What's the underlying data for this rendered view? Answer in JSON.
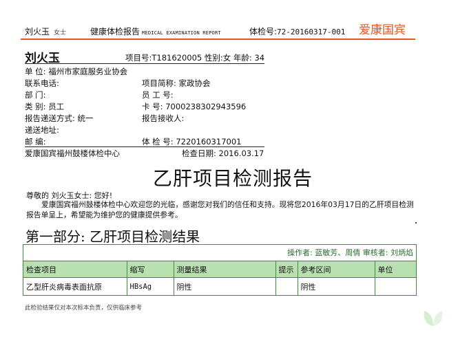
{
  "header": {
    "name": "刘火玉",
    "salutation": "女士",
    "title": "健康体检报告",
    "title_en": "MEDICAL EXAMINATION REPORT",
    "exam_no_label": "体检号:",
    "exam_no": "72-20160317-001",
    "brand": "爱康国宾"
  },
  "patient": {
    "name": "刘火玉",
    "meta": "项目号:T181620005 性别:女 年龄: 34",
    "unit_label": "单    位:",
    "unit": "福州市家庭服务业协会",
    "phone_label": "联系电话:",
    "phone": "",
    "project_abbr_label": "项目简称:",
    "project_abbr": "家政协会",
    "dept_label": "部    门:",
    "dept": "",
    "employee_no_label": "员 工 号:",
    "employee_no": "",
    "category_label": "类    别:",
    "category": "员工",
    "card_label": "卡      号:",
    "card": "7000238302943596",
    "delivery_label": "报告递送方式:",
    "delivery": "统一",
    "receiver_label": "报告接收人:",
    "receiver": "",
    "address_label": "递送地址:",
    "address": "",
    "postcode_label": "邮      编:",
    "postcode": "",
    "exam_no_label": "体 检 号:",
    "exam_no": "7220160317001",
    "center": "爱康国宾福州鼓楼体检中心",
    "exam_date": "检查日期: 2016.03.17"
  },
  "report": {
    "title": "乙肝项目检测报告",
    "greeting": "尊敬的 刘火玉女士: 您好!",
    "intro": "爱康国宾福州鼓楼体检中心欢迎您的光临，感谢您对我们的信任和支持。现将您2016年03月17日的乙肝项目检测报告单呈上，希望能为维护您的健康提供参考。",
    "section_title": "第一部分: 乙肝项目检测结果"
  },
  "table": {
    "staff_line": "操作者: 蓝敏芳、周倩   审核者: 刘炳焰",
    "headers": [
      "检查项目",
      "缩写",
      "测量结果",
      "提示",
      "参考区间",
      "单位"
    ],
    "rows": [
      [
        "乙型肝炎病毒表面抗原",
        "HBsAg",
        "阴性",
        "",
        "阴性",
        ""
      ]
    ]
  },
  "footnote": "此检验结果仅对本次标本负责，仅供临床参考",
  "colors": {
    "brand": "#e8541c",
    "table_border": "#3d8a3d",
    "table_header_bg": "#b9e0b1"
  }
}
